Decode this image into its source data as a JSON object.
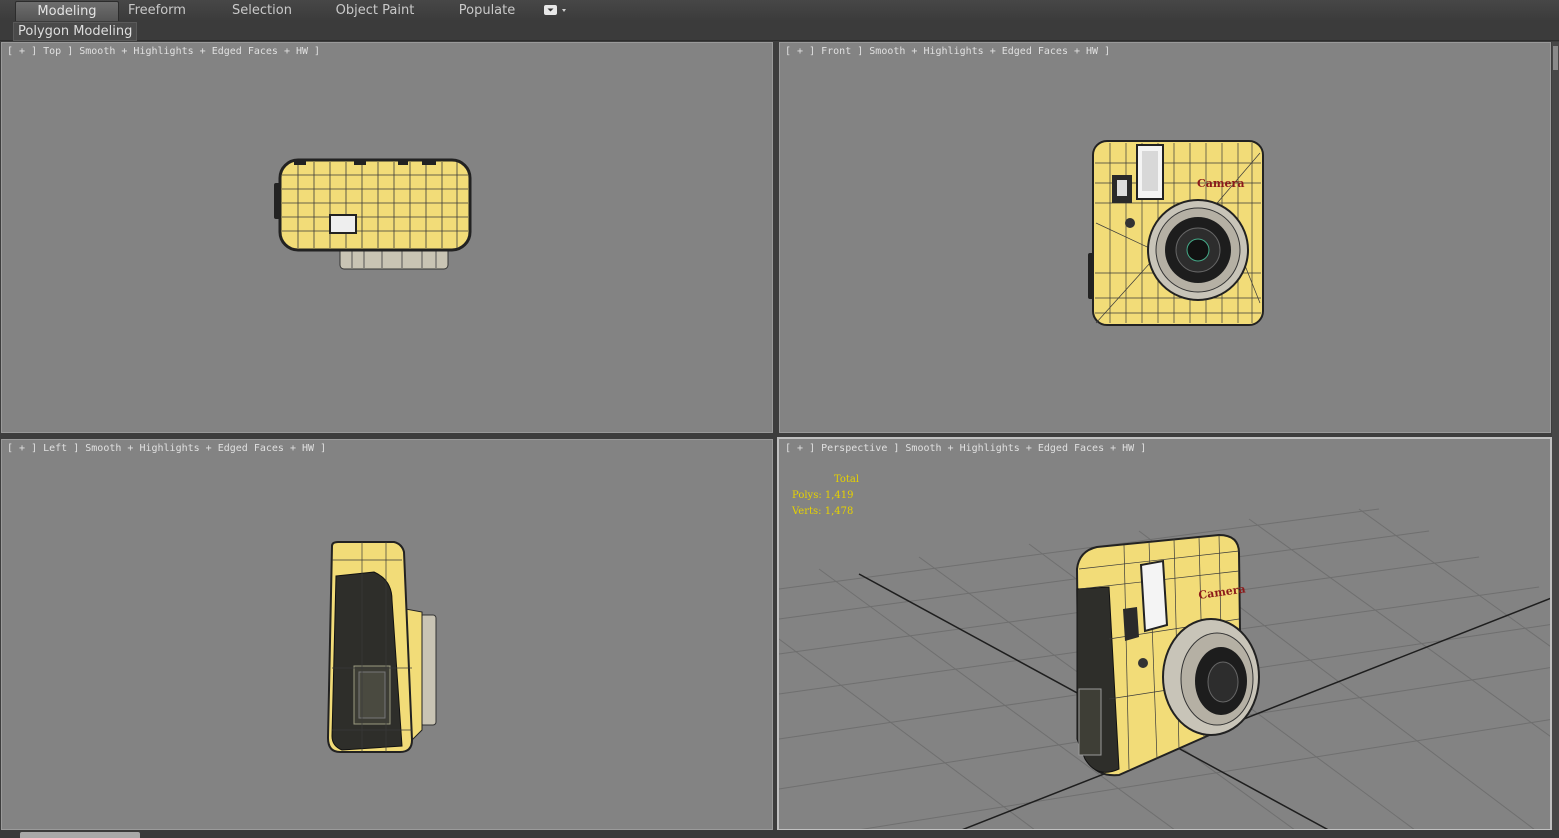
{
  "ribbon": {
    "tabs": [
      {
        "label": "Modeling",
        "active": true
      },
      {
        "label": "Freeform",
        "active": false
      },
      {
        "label": "Selection",
        "active": false
      },
      {
        "label": "Object Paint",
        "active": false
      },
      {
        "label": "Populate",
        "active": false
      }
    ],
    "panel_label": "Polygon Modeling",
    "menu_icon": "dropdown-toggle-icon"
  },
  "viewports": {
    "top": {
      "label": "[ + ] Top ] Smooth + Highlights + Edged Faces + HW ]"
    },
    "front": {
      "label": "[ + ] Front ] Smooth + Highlights + Edged Faces + HW ]",
      "brand_text": "Camera"
    },
    "left": {
      "label": "[ + ] Left ] Smooth + Highlights + Edged Faces + HW ]"
    },
    "perspective": {
      "label": "[ + ] Perspective ] Smooth + Highlights + Edged Faces + HW ]",
      "brand_text": "Camera",
      "stats": {
        "title": "Total",
        "polys_label": "Polys:",
        "polys_value": "1,419",
        "verts_label": "Verts:",
        "verts_value": "1,478"
      }
    }
  },
  "colors": {
    "viewport_bg": "#838383",
    "model_yellow": "#f2dc78",
    "wire": "#2a2a2a",
    "stats_text": "#e6d200",
    "brand_text": "#8b1a1a"
  }
}
